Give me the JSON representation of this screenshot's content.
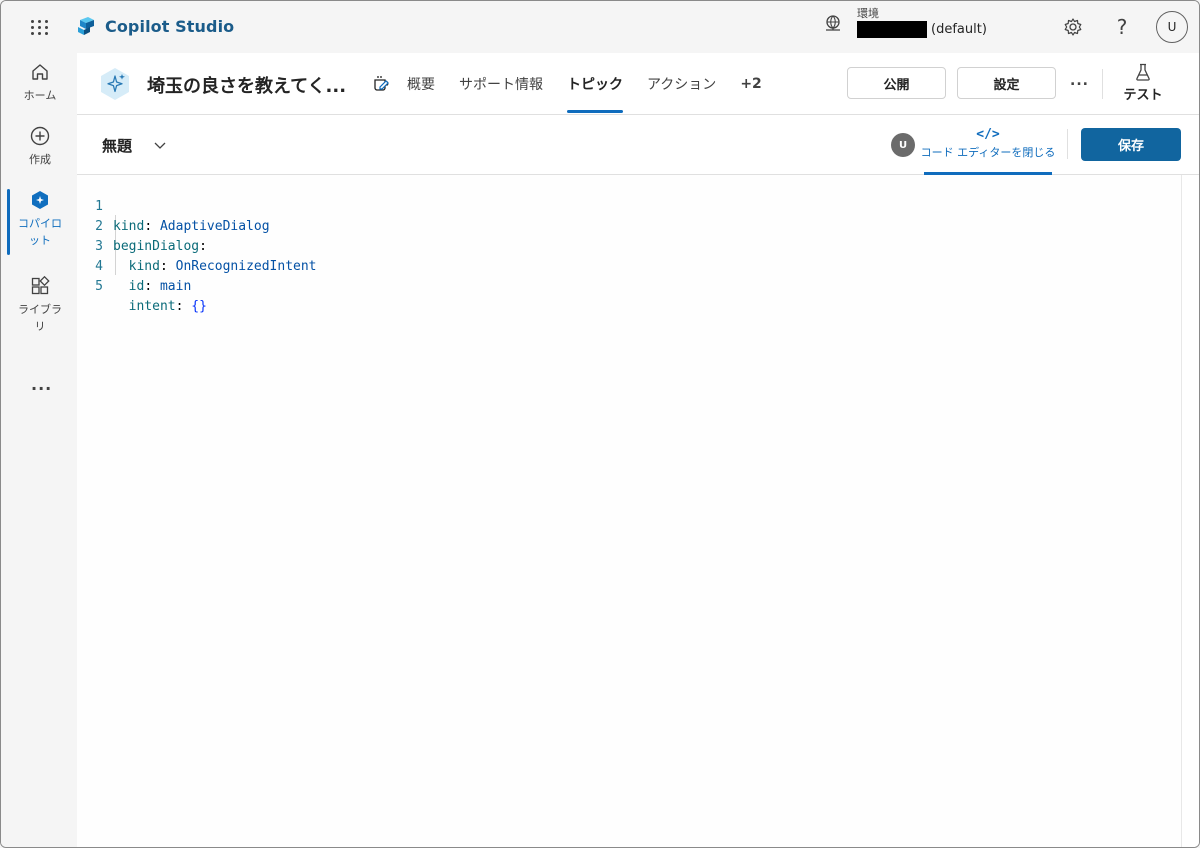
{
  "app": {
    "name": "Copilot Studio"
  },
  "environment": {
    "label": "環境",
    "name": "(default)"
  },
  "top_actions": {
    "settings_icon": "gear-icon",
    "help_label": "?",
    "avatar_initial": "U"
  },
  "nav": {
    "items": [
      {
        "label": "ホーム",
        "icon": "home-icon"
      },
      {
        "label": "作成",
        "icon": "add-circle-icon"
      },
      {
        "label": "コパイロット",
        "icon": "copilot-icon"
      },
      {
        "label": "ライブラリ",
        "icon": "library-icon"
      }
    ],
    "more_label": "..."
  },
  "agent": {
    "title": "埼玉の良さを教えてく..."
  },
  "tabs": [
    {
      "label": "概要"
    },
    {
      "label": "サポート情報"
    },
    {
      "label": "トピック"
    },
    {
      "label": "アクション"
    },
    {
      "label": "+2"
    }
  ],
  "header_buttons": {
    "publish": "公開",
    "settings": "設定",
    "more": "...",
    "test": "テスト"
  },
  "topic": {
    "name": "無題",
    "collab_initial": "U",
    "code_toggle_icon": "</>",
    "code_toggle_label": "コード エディターを閉じる",
    "save": "保存"
  },
  "code": {
    "lines": [
      {
        "num": "1",
        "indent": "",
        "key": "kind",
        "sep": ": ",
        "value": "AdaptiveDialog",
        "vtype": "v"
      },
      {
        "num": "2",
        "indent": "",
        "key": "beginDialog",
        "sep": ":",
        "value": "",
        "vtype": "v"
      },
      {
        "num": "3",
        "indent": "  ",
        "key": "kind",
        "sep": ": ",
        "value": "OnRecognizedIntent",
        "vtype": "v"
      },
      {
        "num": "4",
        "indent": "  ",
        "key": "id",
        "sep": ": ",
        "value": "main",
        "vtype": "v"
      },
      {
        "num": "5",
        "indent": "  ",
        "key": "intent",
        "sep": ": ",
        "value": "{}",
        "vtype": "b"
      }
    ]
  },
  "colors": {
    "accent": "#0f6cbd",
    "save_bg": "#11659f",
    "yaml_key": "#0b6b79",
    "yaml_value": "#0451a5"
  }
}
